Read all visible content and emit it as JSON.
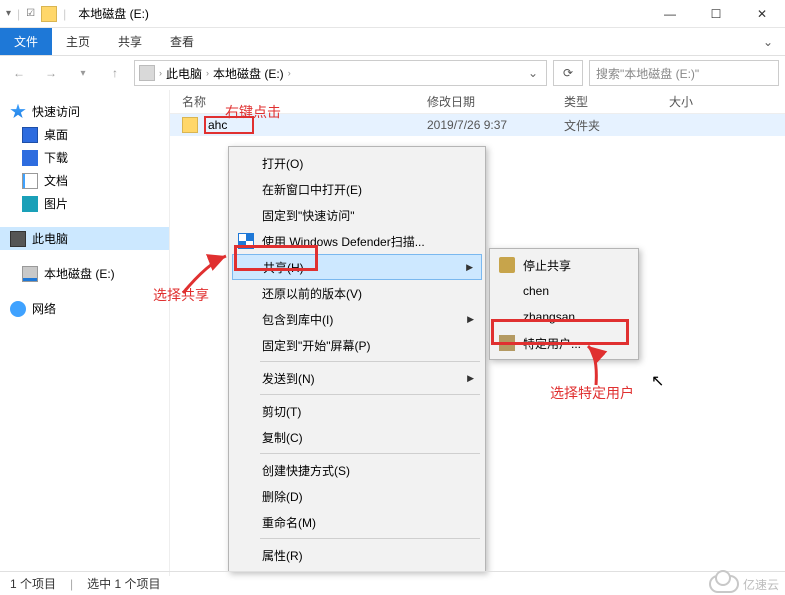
{
  "titlebar": {
    "title": "本地磁盘 (E:)"
  },
  "window_buttons": {
    "min": "—",
    "max": "☐",
    "close": "✕"
  },
  "ribbon": {
    "file": "文件",
    "home": "主页",
    "share": "共享",
    "view": "查看"
  },
  "address": {
    "crumb1": "此电脑",
    "crumb2": "本地磁盘 (E:)"
  },
  "search": {
    "placeholder": "搜索\"本地磁盘 (E:)\""
  },
  "sidebar": {
    "quick": "快速访问",
    "desktop": "桌面",
    "downloads": "下载",
    "documents": "文档",
    "pictures": "图片",
    "this_pc": "此电脑",
    "drive": "本地磁盘 (E:)",
    "network": "网络"
  },
  "columns": {
    "name": "名称",
    "date": "修改日期",
    "type": "类型",
    "size": "大小"
  },
  "file": {
    "name": "ahc",
    "date": "2019/7/26 9:37",
    "type": "文件夹"
  },
  "ctx": {
    "open": "打开(O)",
    "new_window": "在新窗口中打开(E)",
    "pin_quick": "固定到\"快速访问\"",
    "defender": "使用 Windows Defender扫描...",
    "share": "共享(H)",
    "restore": "还原以前的版本(V)",
    "include": "包含到库中(I)",
    "pin_start": "固定到\"开始\"屏幕(P)",
    "send_to": "发送到(N)",
    "cut": "剪切(T)",
    "copy": "复制(C)",
    "shortcut": "创建快捷方式(S)",
    "delete": "删除(D)",
    "rename": "重命名(M)",
    "properties": "属性(R)"
  },
  "share_sub": {
    "stop": "停止共享",
    "chen": "chen",
    "zhangsan": "zhangsan",
    "specific": "特定用户..."
  },
  "annotations": {
    "right_click": "右键点击",
    "choose_share": "选择共享",
    "choose_specific": "选择特定用户"
  },
  "status": {
    "count": "1 个项目",
    "selected": "选中 1 个项目"
  },
  "watermark": "亿速云"
}
